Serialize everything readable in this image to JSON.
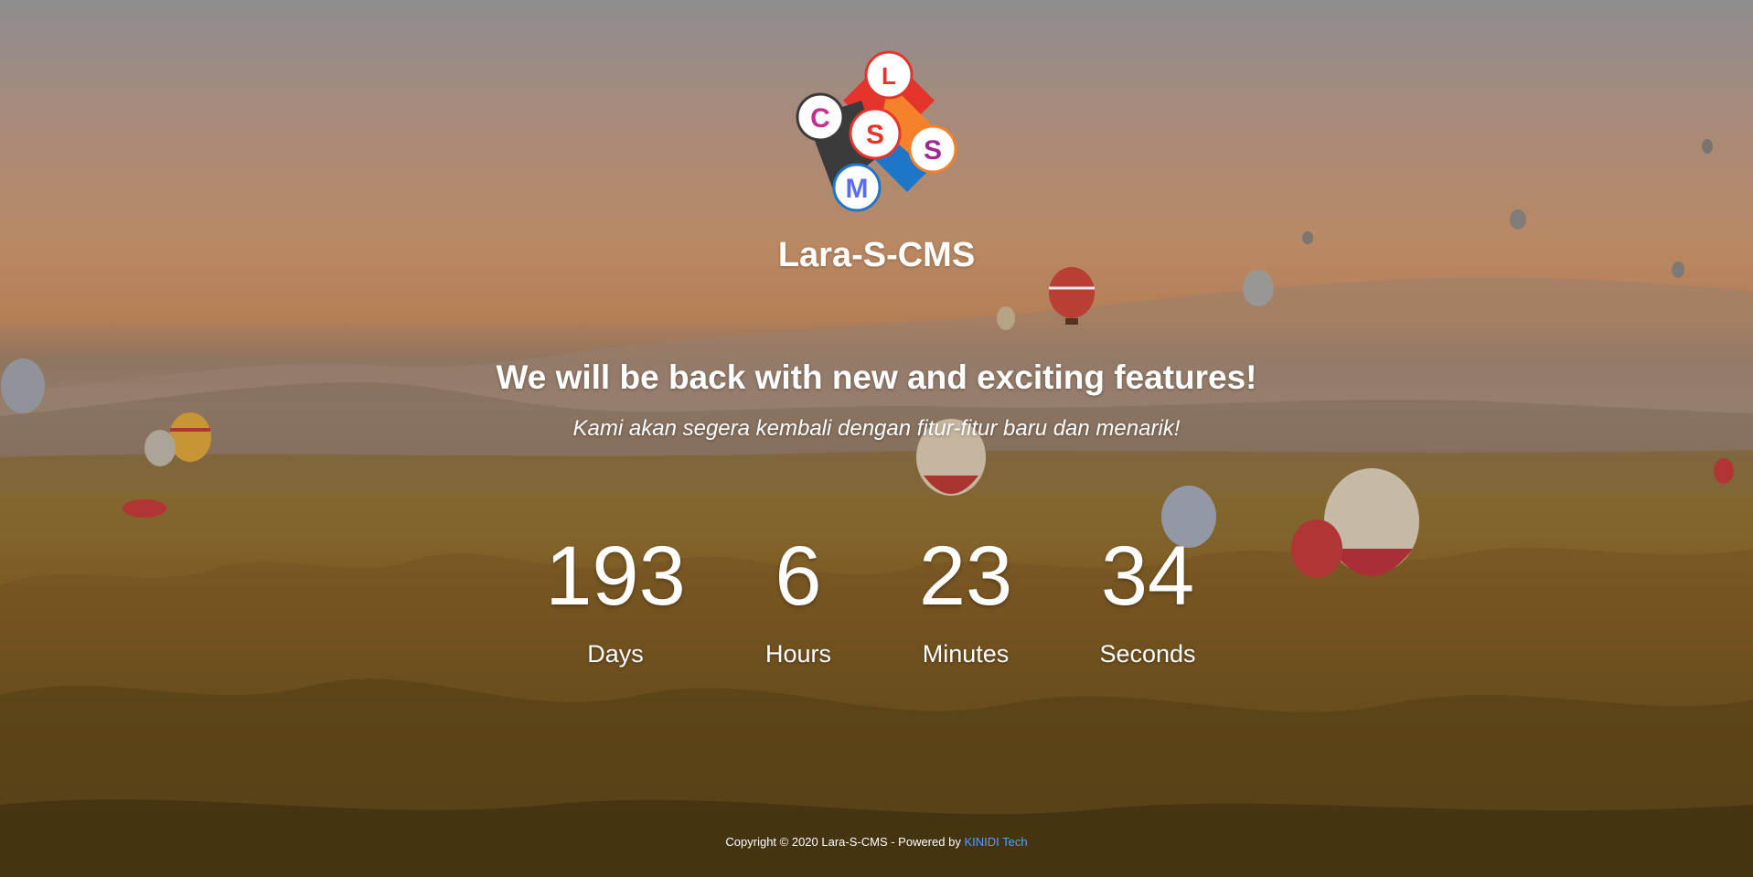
{
  "app": {
    "name": "Lara-S-CMS",
    "logo_letters": [
      "C",
      "S",
      "S",
      "M"
    ]
  },
  "main": {
    "headline": "We will be back with new and exciting features!",
    "subheadline": "Kami akan segera kembali dengan fitur-fitur baru dan menarik!"
  },
  "countdown": {
    "days": {
      "value": "193",
      "label": "Days"
    },
    "hours": {
      "value": "6",
      "label": "Hours"
    },
    "minutes": {
      "value": "23",
      "label": "Minutes"
    },
    "seconds": {
      "value": "34",
      "label": "Seconds"
    }
  },
  "footer": {
    "copyright": "Copyright © 2020 Lara-S-CMS - Powered by",
    "link_text": "KINIDI Tech"
  },
  "colors": {
    "text": "#ffffff",
    "link": "#4aa3ff",
    "logo_red": "#e5352b",
    "logo_orange": "#f5812a",
    "logo_blue": "#1e76c9",
    "logo_dark": "#3b3b3b"
  }
}
